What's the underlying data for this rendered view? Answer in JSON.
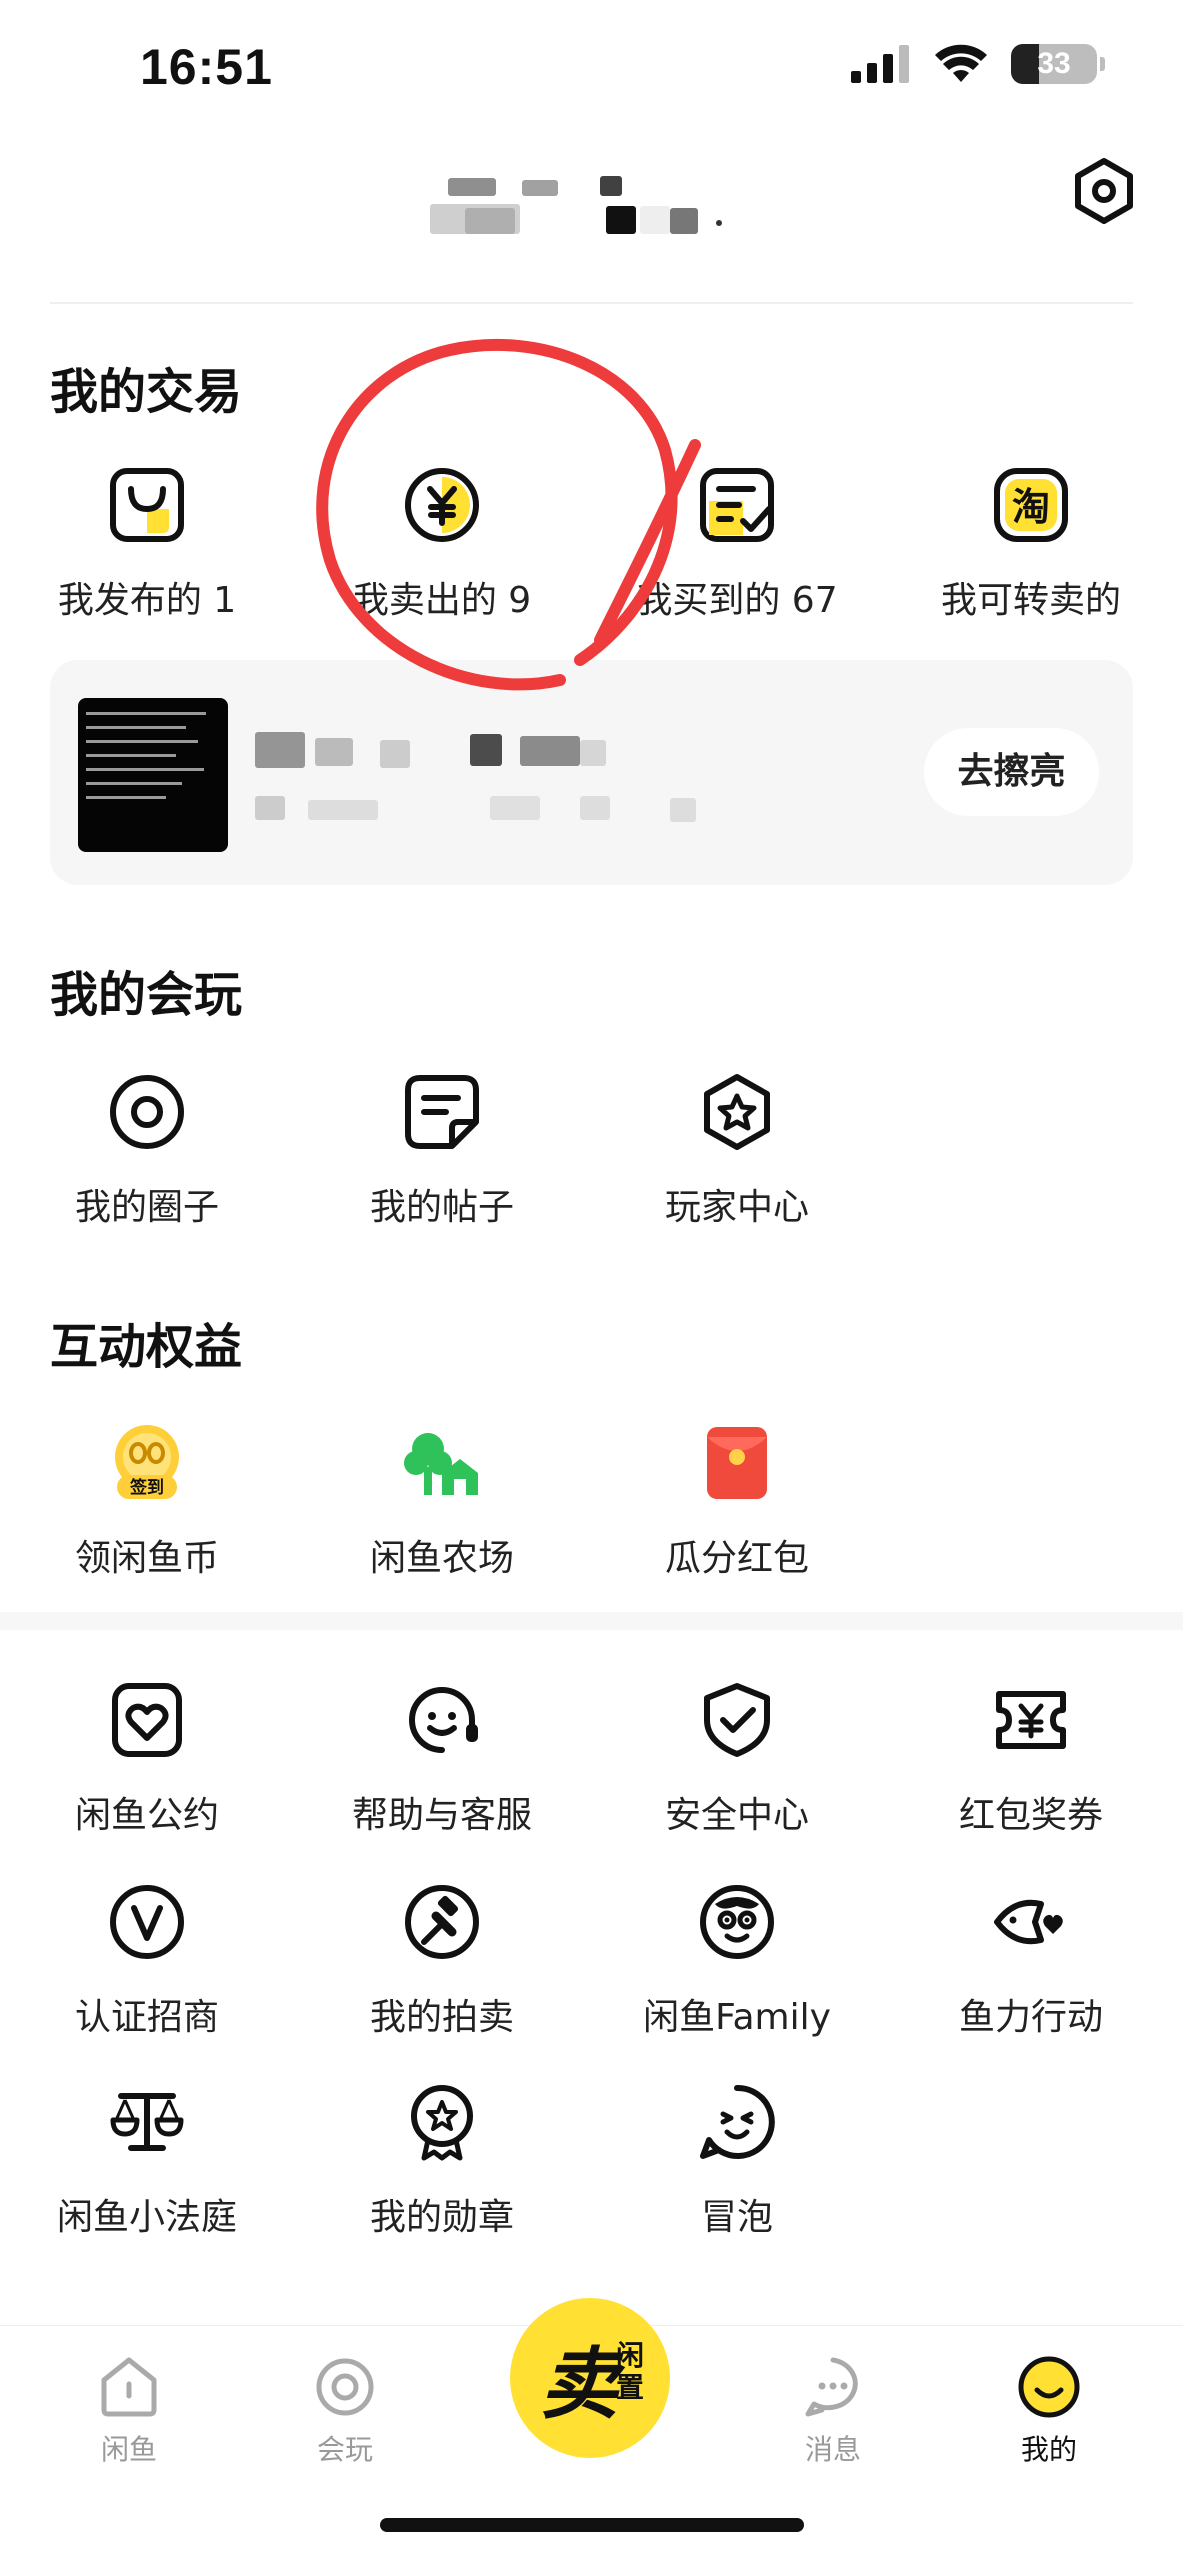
{
  "status_bar": {
    "time": "16:51",
    "battery": "33",
    "battery_level_percent": 33
  },
  "header": {
    "settings_icon": "hexagon-settings-icon"
  },
  "transactions": {
    "title": "我的交易",
    "items": [
      {
        "label": "我发布的 1",
        "icon": "published-icon"
      },
      {
        "label": "我卖出的 9",
        "icon": "yen-sold-icon"
      },
      {
        "label": "我买到的 67",
        "icon": "bought-check-icon"
      },
      {
        "label": "我可转卖的",
        "icon": "taobao-icon"
      }
    ],
    "promo_button": "去擦亮"
  },
  "play": {
    "title": "我的会玩",
    "items": [
      {
        "label": "我的圈子",
        "icon": "circle-icon"
      },
      {
        "label": "我的帖子",
        "icon": "post-icon"
      },
      {
        "label": "玩家中心",
        "icon": "star-hexagon-icon"
      }
    ]
  },
  "benefits": {
    "title": "互动权益",
    "items": [
      {
        "label": "领闲鱼币",
        "icon": "coin-checkin-icon",
        "badge": "签到"
      },
      {
        "label": "闲鱼农场",
        "icon": "farm-icon"
      },
      {
        "label": "瓜分红包",
        "icon": "red-envelope-icon"
      }
    ]
  },
  "services": {
    "items": [
      {
        "label": "闲鱼公约",
        "icon": "heart-document-icon"
      },
      {
        "label": "帮助与客服",
        "icon": "headset-icon"
      },
      {
        "label": "安全中心",
        "icon": "shield-check-icon"
      },
      {
        "label": "红包奖券",
        "icon": "yen-ticket-icon"
      },
      {
        "label": "认证招商",
        "icon": "verified-v-icon"
      },
      {
        "label": "我的拍卖",
        "icon": "auction-hammer-icon"
      },
      {
        "label": "闲鱼Family",
        "icon": "monkey-face-icon"
      },
      {
        "label": "鱼力行动",
        "icon": "fish-heart-icon"
      },
      {
        "label": "闲鱼小法庭",
        "icon": "scales-icon"
      },
      {
        "label": "我的勋章",
        "icon": "medal-icon"
      },
      {
        "label": "冒泡",
        "icon": "bubble-face-icon"
      }
    ]
  },
  "tab_bar": {
    "tabs": [
      {
        "label": "闲鱼",
        "icon": "home-icon"
      },
      {
        "label": "会玩",
        "icon": "circle-icon"
      },
      {
        "label": "消息",
        "icon": "message-icon"
      },
      {
        "label": "我的",
        "icon": "smile-face-icon"
      }
    ],
    "sell_main": "卖",
    "sell_sub": "闲置",
    "active_tab": "我的"
  },
  "colors": {
    "accent_yellow": "#ffe033",
    "annotation_red": "#ee3b3b",
    "farm_green": "#2fc25b",
    "red_envelope": "#f04a3c"
  }
}
